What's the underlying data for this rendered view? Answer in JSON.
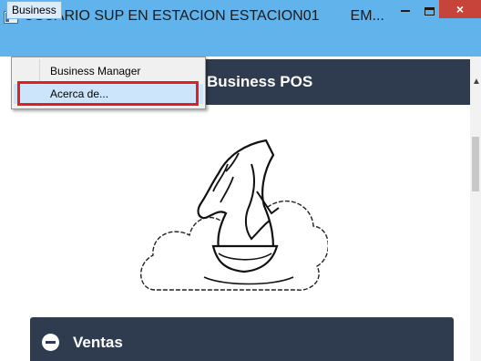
{
  "window": {
    "title": "USUARIO SUP EN ESTACION ESTACION01",
    "title_extra": "EM...",
    "controls": {
      "minimize": "minimize",
      "maximize": "maximize",
      "close": "×"
    }
  },
  "menubar": {
    "items": [
      {
        "label": "Business"
      }
    ]
  },
  "dropdown": {
    "items": [
      {
        "label": "Business Manager"
      },
      {
        "label": "Acerca de..."
      }
    ],
    "highlighted_index": 1
  },
  "app": {
    "header_title": "Business POS",
    "sections": [
      {
        "label": "Ventas",
        "state": "expanded"
      }
    ]
  },
  "colors": {
    "titlebar": "#61b3ec",
    "header": "#2f3b4e",
    "close": "#c7443a",
    "highlight": "#e02020"
  }
}
